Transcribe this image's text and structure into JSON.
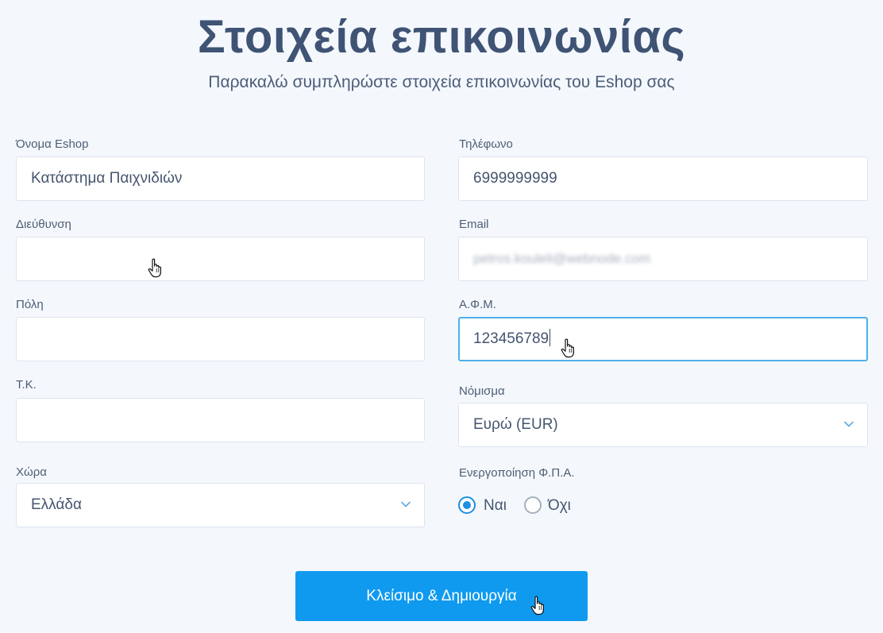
{
  "header": {
    "title": "Στοιχεία επικοινωνίας",
    "subtitle": "Παρακαλώ συμπληρώστε στοιχεία επικοινωνίας του Eshop σας"
  },
  "form": {
    "shop_name": {
      "label": "Όνομα Eshop",
      "value": "Κατάστημα Παιχνιδιών"
    },
    "phone": {
      "label": "Τηλέφωνο",
      "value": "6999999999"
    },
    "address": {
      "label": "Διεύθυνση",
      "value": ""
    },
    "email": {
      "label": "Email",
      "value": "petros.kouleli@webnode.com"
    },
    "city": {
      "label": "Πόλη",
      "value": ""
    },
    "vat_number": {
      "label": "Α.Φ.Μ.",
      "value": "123456789"
    },
    "postal_code": {
      "label": "Τ.Κ.",
      "value": ""
    },
    "currency": {
      "label": "Νόμισμα",
      "selected": "Ευρώ (EUR)"
    },
    "country": {
      "label": "Χώρα",
      "selected": "Ελλάδα"
    },
    "vat_enabled": {
      "label": "Ενεργοποίηση Φ.Π.Α.",
      "options": [
        {
          "label": "Ναι",
          "checked": true
        },
        {
          "label": "Όχι",
          "checked": false
        }
      ]
    }
  },
  "actions": {
    "submit_label": "Κλείσιμο & Δημιουργία"
  },
  "colors": {
    "background": "#f4f8fd",
    "title": "#3f5474",
    "accent": "#0f9aef",
    "focus_border": "#4fb0e8",
    "radio_checked": "#1f8fe0"
  },
  "icons": {
    "select_arrow": "chevron-down-icon",
    "pointer": "hand-pointer-cursor"
  }
}
